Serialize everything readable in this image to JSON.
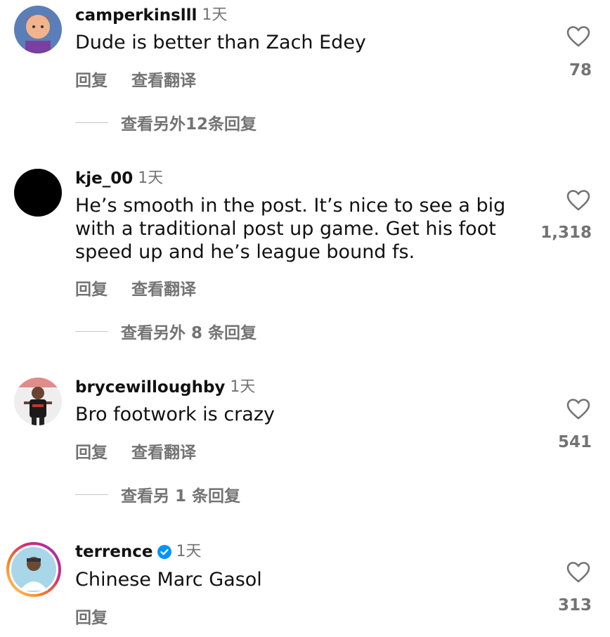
{
  "comments": [
    {
      "username": "camperkinslll",
      "time": "1天",
      "text": "Dude is better than Zach Edey",
      "reply_label": "回复",
      "translate_label": "查看翻译",
      "view_replies": "查看另外12条回复",
      "likes": "78"
    },
    {
      "username": "kje_00",
      "time": "1天",
      "text": "He’s smooth in the post. It’s nice to see a big with a traditional post up game. Get his foot speed up and he’s league bound fs.",
      "reply_label": "回复",
      "translate_label": "查看翻译",
      "view_replies": "查看另外 8 条回复",
      "likes": "1,318"
    },
    {
      "username": "brycewilloughby",
      "time": "1天",
      "text": "Bro footwork is crazy",
      "reply_label": "回复",
      "translate_label": "查看翻译",
      "view_replies": "查看另 1 条回复",
      "likes": "541"
    },
    {
      "username": "terrence",
      "time": "1天",
      "text": "Chinese Marc Gasol",
      "reply_label": "回复",
      "likes": "313"
    }
  ],
  "colors": {
    "secondary_text": "#737373",
    "verified_blue": "#0095f6"
  }
}
